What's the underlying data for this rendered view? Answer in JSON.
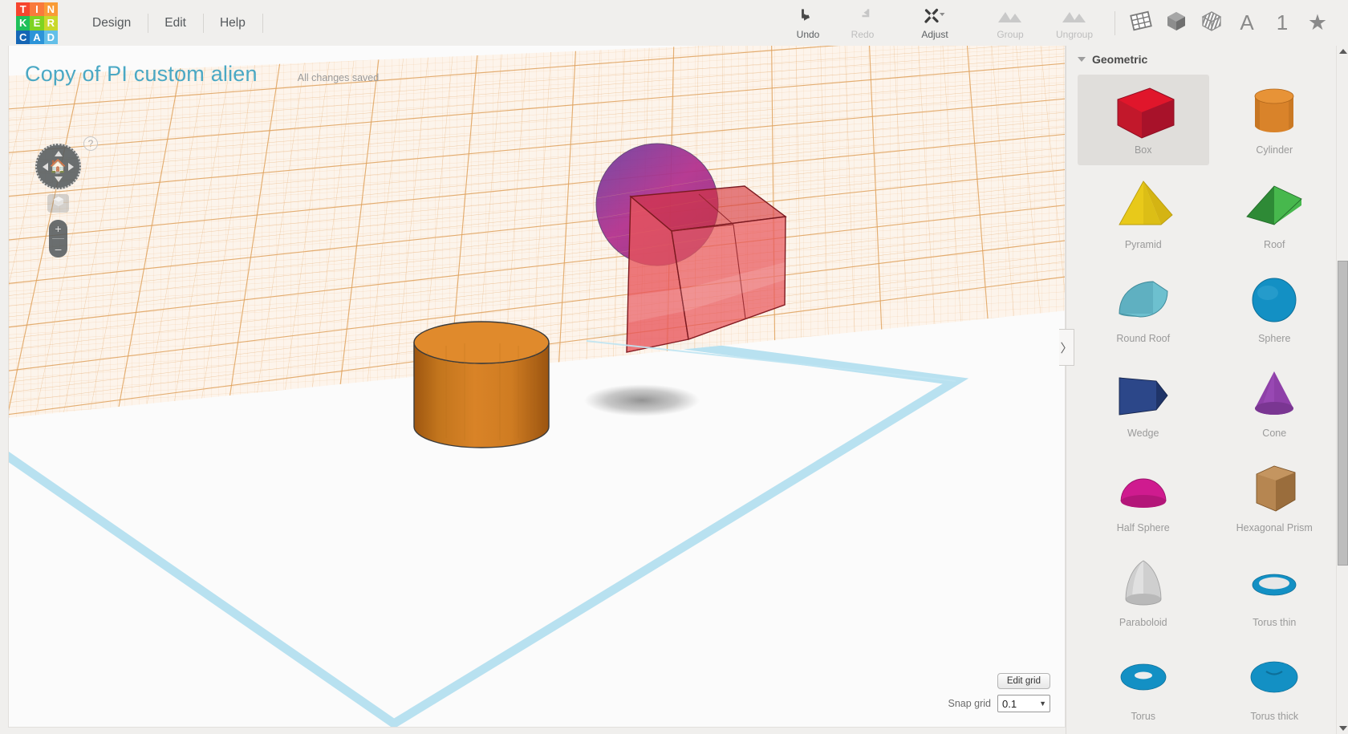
{
  "app": {
    "logo_letters": [
      {
        "ch": "T",
        "color": "#f6452e"
      },
      {
        "ch": "I",
        "color": "#f97a3c"
      },
      {
        "ch": "N",
        "color": "#f99b36"
      },
      {
        "ch": "K",
        "color": "#1fc05a"
      },
      {
        "ch": "E",
        "color": "#7ed321"
      },
      {
        "ch": "R",
        "color": "#c9d82b"
      },
      {
        "ch": "C",
        "color": "#1566b5"
      },
      {
        "ch": "A",
        "color": "#2c94d8"
      },
      {
        "ch": "D",
        "color": "#63bfe8"
      }
    ],
    "menus": [
      {
        "label": "Design",
        "name": "menu-design"
      },
      {
        "label": "Edit",
        "name": "menu-edit"
      },
      {
        "label": "Help",
        "name": "menu-help"
      }
    ]
  },
  "toolbar": {
    "undo": {
      "label": "Undo",
      "icon": "undo-icon",
      "enabled": true
    },
    "redo": {
      "label": "Redo",
      "icon": "redo-icon",
      "enabled": false
    },
    "adjust": {
      "label": "Adjust",
      "icon": "adjust-icon",
      "enabled": true
    },
    "group": {
      "label": "Group",
      "icon": "group-icon",
      "enabled": false
    },
    "ungroup": {
      "label": "Ungroup",
      "icon": "ungroup-icon",
      "enabled": false
    },
    "icons": [
      {
        "name": "workplane-icon",
        "glyph": "grid"
      },
      {
        "name": "solid-shape-icon",
        "glyph": "cube"
      },
      {
        "name": "hole-shape-icon",
        "glyph": "striped-cube"
      },
      {
        "name": "text-icon",
        "glyph": "A"
      },
      {
        "name": "number-icon",
        "glyph": "1"
      },
      {
        "name": "favorites-star-icon",
        "glyph": "star"
      }
    ]
  },
  "canvas": {
    "design_title": "Copy of PI custom alien",
    "save_status": "All changes saved",
    "help_glyph": "?",
    "zoom_in": "+",
    "zoom_out": "–",
    "edit_grid_label": "Edit grid",
    "snap_grid_label": "Snap grid",
    "snap_grid_value": "0.1",
    "colors": {
      "grid_orange": "#e39c4e",
      "plane_blue": "#b8e1f0",
      "box_red": "#ea5055",
      "sphere_magenta": "#b7338f",
      "cylinder_orange": "#da8126",
      "title_teal": "#4aa8c4"
    },
    "objects": [
      {
        "name": "cylinder-object",
        "shape": "cylinder",
        "color": "#da8126"
      },
      {
        "name": "box-object",
        "shape": "box",
        "color": "#ea5055",
        "transparent": true
      },
      {
        "name": "sphere-object",
        "shape": "sphere",
        "color": "#b7338f",
        "transparent": true
      }
    ]
  },
  "panel": {
    "collapse_glyph": "〉",
    "category": "Geometric",
    "shapes": [
      {
        "label": "Box",
        "art": "box",
        "selected": true
      },
      {
        "label": "Cylinder",
        "art": "cylinder",
        "selected": false
      },
      {
        "label": "Pyramid",
        "art": "pyramid",
        "selected": false
      },
      {
        "label": "Roof",
        "art": "roof",
        "selected": false
      },
      {
        "label": "Round Roof",
        "art": "roundroof",
        "selected": false
      },
      {
        "label": "Sphere",
        "art": "sphere",
        "selected": false
      },
      {
        "label": "Wedge",
        "art": "wedge",
        "selected": false
      },
      {
        "label": "Cone",
        "art": "cone",
        "selected": false
      },
      {
        "label": "Half Sphere",
        "art": "halfsphere",
        "selected": false
      },
      {
        "label": "Hexagonal Prism",
        "art": "hexprism",
        "selected": false
      },
      {
        "label": "Paraboloid",
        "art": "paraboloid",
        "selected": false
      },
      {
        "label": "Torus thin",
        "art": "torusthin",
        "selected": false
      },
      {
        "label": "Torus",
        "art": "torus",
        "selected": false
      },
      {
        "label": "Torus thick",
        "art": "torusthick",
        "selected": false
      }
    ]
  }
}
